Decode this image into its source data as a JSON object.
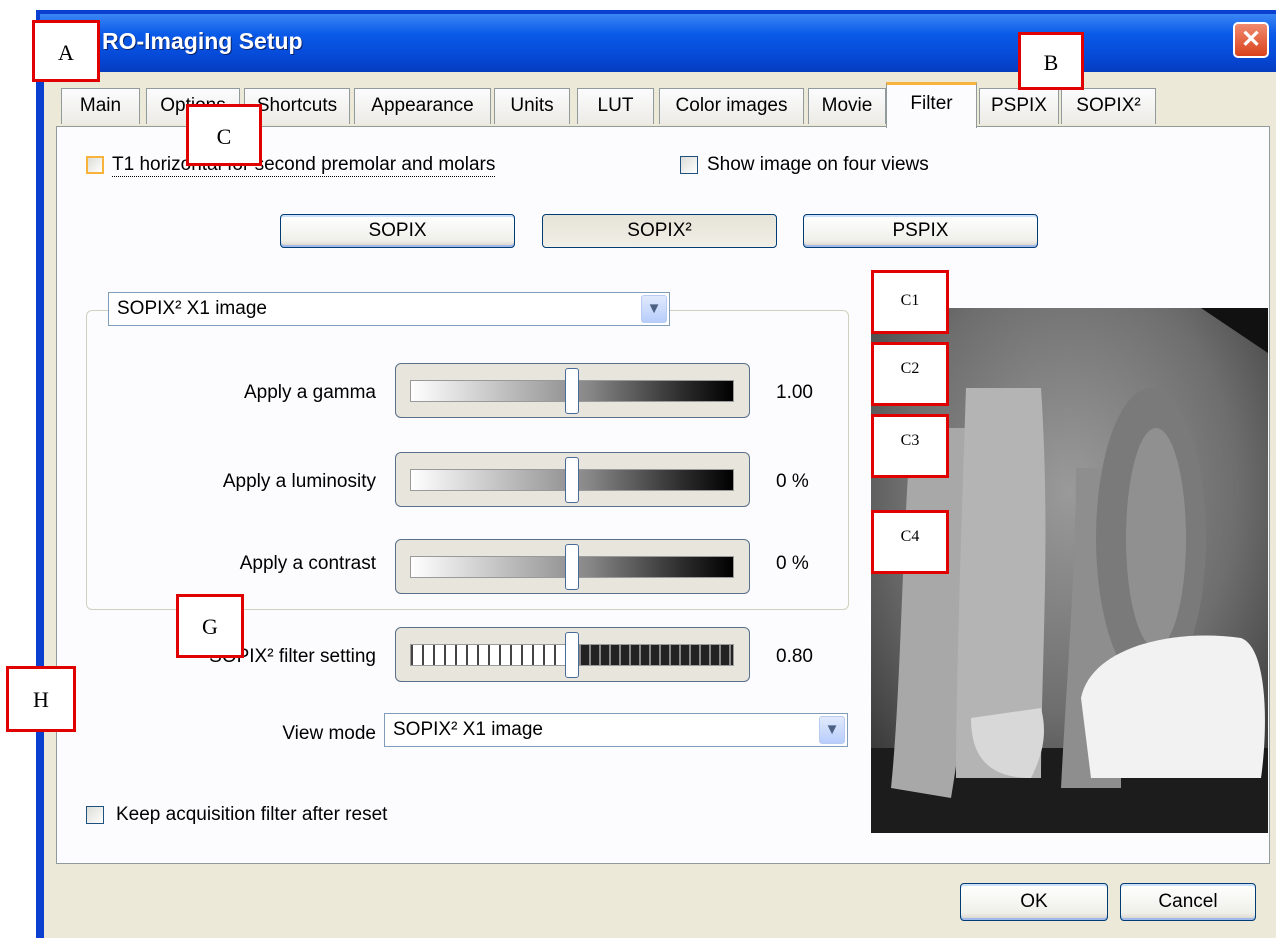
{
  "window": {
    "title": "RO-Imaging Setup",
    "close_glyph": "✕"
  },
  "tabs": [
    "Main",
    "Options",
    "Shortcuts",
    "Appearance",
    "Units",
    "LUT",
    "Color images",
    "Movie",
    "Filter",
    "PSPIX",
    "SOPIX²"
  ],
  "active_tab": "Filter",
  "options": {
    "t1_label": "T1 horizontal for second premolar and molars",
    "four_views_label": "Show image on four views",
    "keep_filter_label": "Keep acquisition filter after reset"
  },
  "filter_buttons": {
    "sopix": "SOPIX",
    "sopix2": "SOPIX²",
    "pspix": "PSPIX",
    "selected": "SOPIX²"
  },
  "group": {
    "combo_value": "SOPIX² X1 image",
    "sliders": [
      {
        "label": "Apply a gamma",
        "value": "1.00",
        "level": 0.5
      },
      {
        "label": "Apply a luminosity",
        "value": "0 %",
        "level": 0.5
      },
      {
        "label": "Apply a contrast",
        "value": "0 %",
        "level": 0.5
      }
    ]
  },
  "filter_setting": {
    "label": "SOPIX² filter setting",
    "value": "0.80",
    "level": 0.5
  },
  "view_mode": {
    "label": "View mode",
    "value": "SOPIX² X1 image"
  },
  "dialog_buttons": {
    "ok": "OK",
    "cancel": "Cancel"
  },
  "preview": {
    "icon": "dental-xray-image"
  },
  "annotations": {
    "A": "A",
    "B": "B",
    "C": "C",
    "C1": "C1",
    "C2": "C2",
    "C3": "C3",
    "C4": "C4",
    "G": "G",
    "H": "H"
  },
  "colors": {
    "title_bar": "#0a5ae8",
    "dialog_bg": "#ece9d8",
    "tab_highlight": "#f8b33c",
    "annotation_border": "#e00000",
    "close_button": "#d9431c"
  }
}
